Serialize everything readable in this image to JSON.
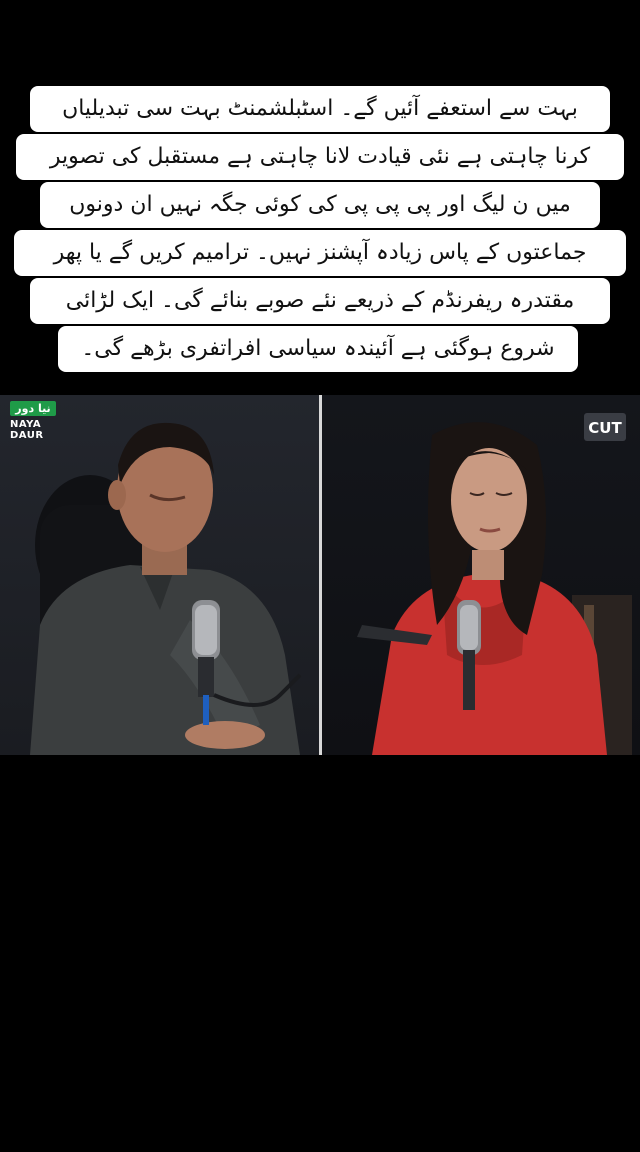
{
  "caption": {
    "lines": [
      "بہت سے استعفے آئیں گے۔ اسٹبلشمنٹ بہت سی تبدیلیاں",
      "کرنا چاہتی ہے نئی قیادت لانا چاہتی ہے مستقبل کی تصویر",
      "میں ن لیگ اور پی پی پی کی کوئی جگہ نہیں ان دونوں",
      "جماعتوں کے پاس زیادہ آپشنز نہیں۔ ترامیم کریں گے یا پھر",
      "مقتدرہ ریفرنڈم کے ذریعے نئے صوبے بنائے گی۔ ایک لڑائی",
      "شروع ہوگئی ہے آئیندہ سیاسی افراتفری بڑھے گی۔"
    ]
  },
  "video": {
    "left_logo": {
      "urdu": "نیا دور",
      "line1": "NAYA",
      "line2": "DAUR",
      "icon": "naya-daur-logo"
    },
    "right_logo": {
      "small": "",
      "text": "CUT",
      "icon": "cut-logo"
    },
    "colors": {
      "accent_green": "#1f9b48",
      "shirt_red": "#c8312f",
      "shirt_dark": "#3b3e3f"
    }
  }
}
